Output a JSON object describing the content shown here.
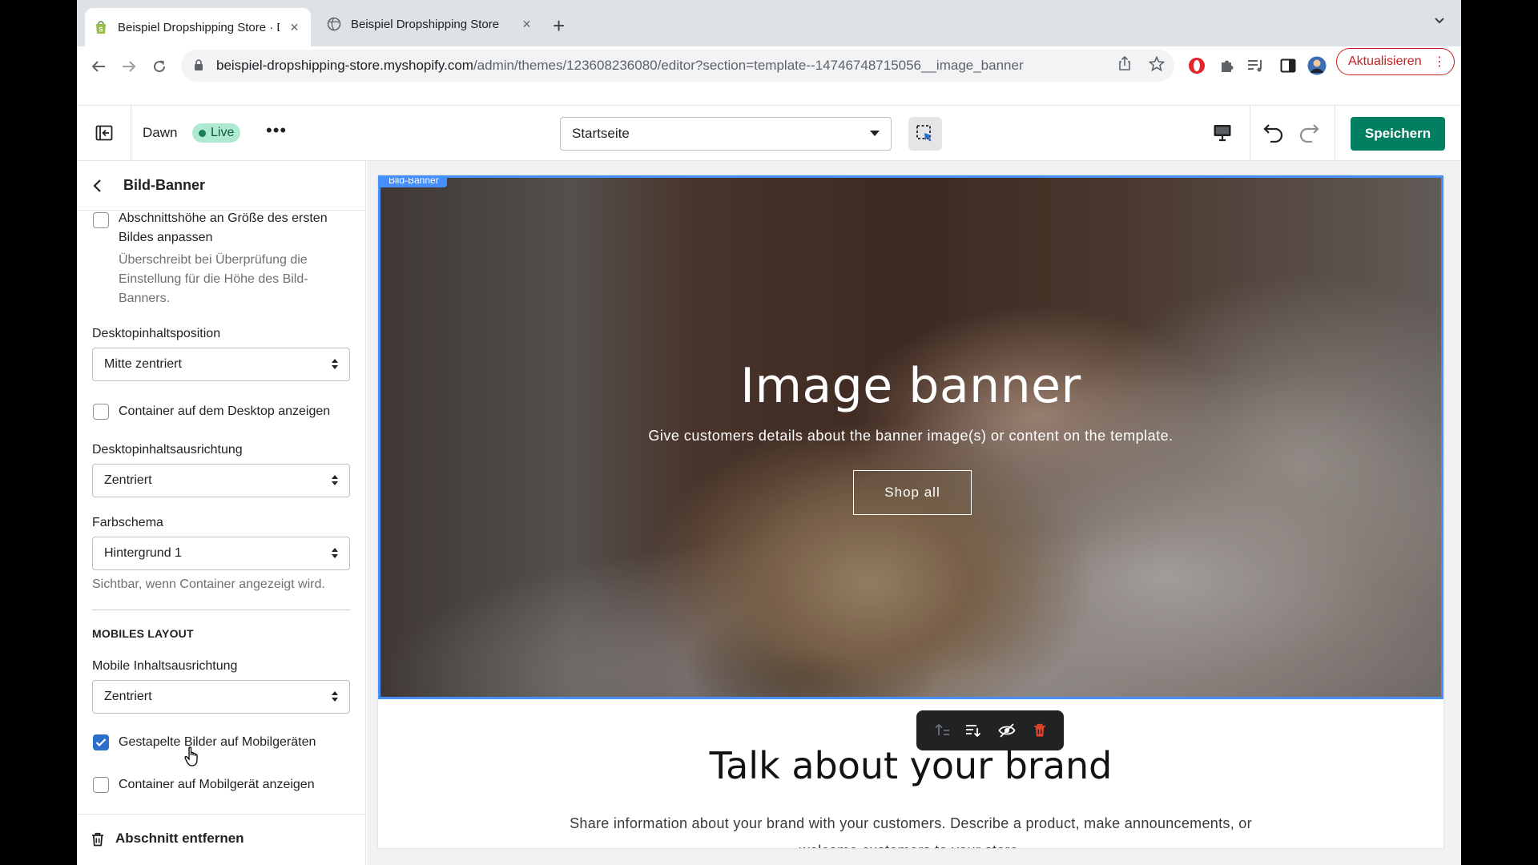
{
  "browser": {
    "tabs": [
      {
        "title": "Beispiel Dropshipping Store · D",
        "active": true
      },
      {
        "title": "Beispiel Dropshipping Store",
        "active": false
      }
    ],
    "url_host": "beispiel-dropshipping-store.myshopify.com",
    "url_path": "/admin/themes/123608236080/editor?section=template--14746748715056__image_banner",
    "update_label": "Aktualisieren"
  },
  "editor": {
    "theme_name": "Dawn",
    "live_label": "Live",
    "page_select": "Startseite",
    "save_label": "Speichern",
    "accent": "#008060"
  },
  "sidebar": {
    "title": "Bild-Banner",
    "adapt_height_label_1": "Abschnittshöhe an Größe des ersten",
    "adapt_height_label_2": "Bildes anpassen",
    "adapt_height_help_1": "Überschreibt bei Überprüfung die",
    "adapt_height_help_2": "Einstellung für die Höhe des Bild-",
    "adapt_height_help_3": "Banners.",
    "desktop_position_label": "Desktopinhaltsposition",
    "desktop_position_value": "Mitte zentriert",
    "desktop_container_label": "Container auf dem Desktop anzeigen",
    "desktop_alignment_label": "Desktopinhaltsausrichtung",
    "desktop_alignment_value": "Zentriert",
    "color_scheme_label": "Farbschema",
    "color_scheme_value": "Hintergrund 1",
    "color_scheme_help": "Sichtbar, wenn Container angezeigt wird.",
    "mobile_heading": "MOBILES LAYOUT",
    "mobile_alignment_label": "Mobile Inhaltsausrichtung",
    "mobile_alignment_value": "Zentriert",
    "stacked_images_label": "Gestapelte Bilder auf Mobilgeräten",
    "stacked_images_checked": true,
    "mobile_container_label": "Container auf Mobilgerät anzeigen",
    "remove_section_label": "Abschnitt entfernen"
  },
  "preview": {
    "banner_badge": "Bild-Banner",
    "banner_title": "Image banner",
    "banner_subtitle": "Give customers details about the banner image(s) or content on the template.",
    "banner_button": "Shop all",
    "brand_title": "Talk about your brand",
    "brand_text_1": "Share information about your brand with your customers. Describe a product, make announcements, or",
    "brand_text_2": "welcome customers to your store.",
    "selection_color": "#458fff"
  }
}
